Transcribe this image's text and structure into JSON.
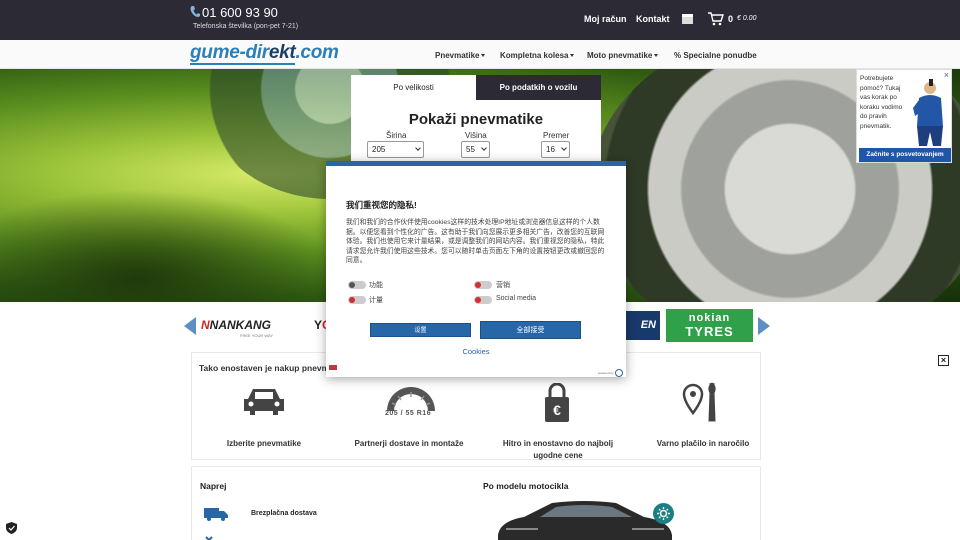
{
  "topbar": {
    "phone": "01 600 93 90",
    "phone_sub": "Telefonska številka (pon-pet 7-21)",
    "account": "Moj račun",
    "contact": "Kontakt",
    "cart_count": "0",
    "cart_total": "€ 0.00"
  },
  "nav": {
    "logo_main": "gume-dir",
    "logo_dark": "ekt",
    "logo_tld": ".com",
    "items": [
      "Pnevmatike",
      "Kompletna kolesa",
      "Moto pnevmatike",
      "% Specialne ponudbe"
    ]
  },
  "search": {
    "tab_size": "Po velikosti",
    "tab_vehicle": "Po podatkih o vozilu",
    "title": "Pokaži pnevmatike",
    "width_label": "Širina",
    "width_value": "205",
    "height_label": "Višina",
    "height_value": "55",
    "diameter_label": "Premer",
    "diameter_value": "16"
  },
  "help": {
    "text": "Potrebujete pomoč? Tukaj vas korak po koraku vodimo do pravih pnevmatik.",
    "close": "×",
    "button": "Začnite s posvetovanjem"
  },
  "brands": {
    "nankang_n": "N",
    "nankang": "NANKANG",
    "nankang_sub": "FREE YOUR WAY",
    "yoko_y": "Y",
    "yoko_o": "O",
    "blue": "EN",
    "nokian_1": "nokian",
    "nokian_2": "TYRES"
  },
  "info": {
    "title": "Tako enostaven je nakup pnevmatik",
    "tire_size": "205 / 55 R16",
    "features": [
      "Izberite pnevmatike",
      "Partnerji dostave in montaže",
      "Hitro in enostavno do najbolj ugodne cene",
      "Varno plačilo in naročilo"
    ]
  },
  "bottom": {
    "left_title": "Naprej",
    "right_title": "Po modelu motocikla",
    "free_delivery": "Brezplačna dostava"
  },
  "close_x": "×",
  "cookie": {
    "title": "我们重视您的隐私!",
    "body": "我们和我们的合作伙伴使用cookies这样的技术处理IP地址或浏览器信息这样的个人数据。以便您看到个性化的广告。这有助于我们向您展示更多相关广告，改善您的互联网体验。我们也使用它来计量结果，或是调整我们的网站内容。我们重视您的隐私，特此请求您允许我们使用这些技术。您可以随时单击页面左下角的设置按钮更改或撤回您的同意。",
    "toggles": [
      "功能",
      "营销",
      "计量",
      "Social media"
    ],
    "btn_settings": "设置",
    "btn_accept": "全部接受",
    "cookies_link": "Cookies",
    "powered": "powered by"
  },
  "colors": {
    "dark_bar": "#2b2a35",
    "brand_blue": "#2767a8",
    "logo_blue": "#2d7fb8",
    "nokian_green": "#2fa14a"
  }
}
